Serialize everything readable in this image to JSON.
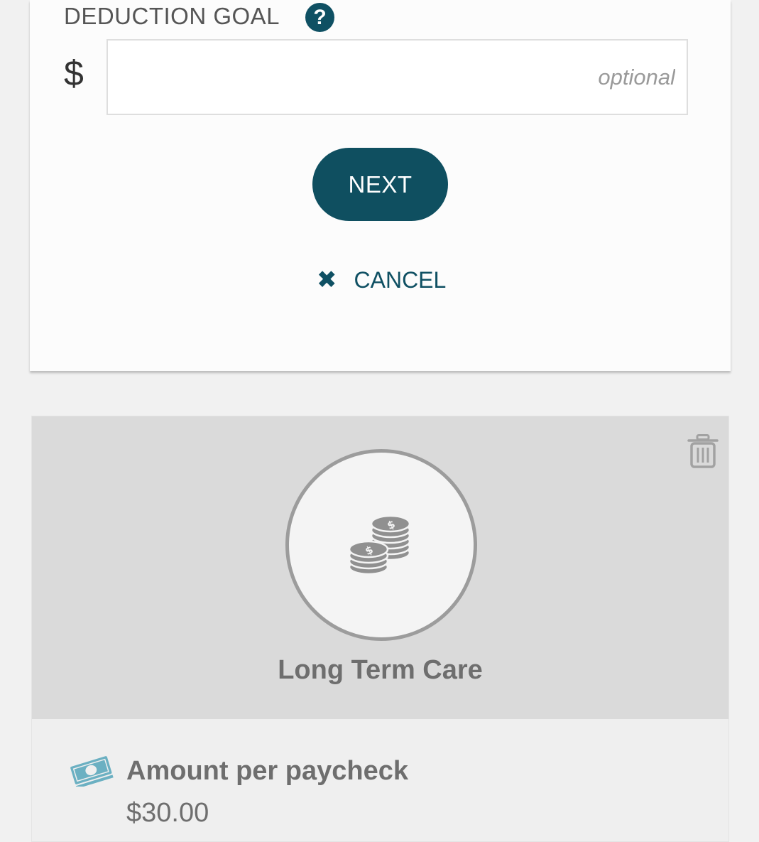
{
  "goal": {
    "label": "DEDUCTION GOAL",
    "help_glyph": "?",
    "currency": "$",
    "value": "",
    "placeholder": "optional"
  },
  "actions": {
    "next_label": "NEXT",
    "cancel_label": "CANCEL"
  },
  "deduction": {
    "title": "Long Term Care",
    "icon": "coins-stack-icon",
    "amount_label": "Amount per paycheck",
    "amount_value": "$30.00"
  },
  "colors": {
    "primary": "#0f5063",
    "money_icon": "#6bb0c2",
    "muted_text": "#6e6e6e"
  }
}
